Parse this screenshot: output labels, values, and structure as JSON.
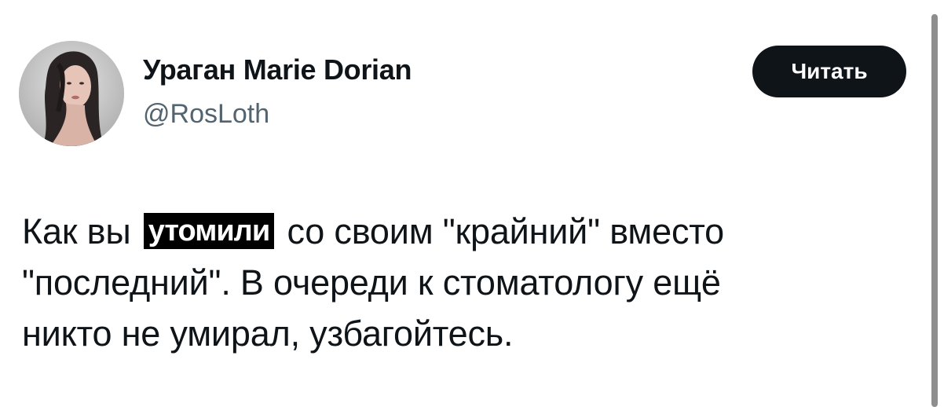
{
  "tweet": {
    "author": {
      "display_name": "Ураган Marie Dorian",
      "handle": "@RosLoth",
      "avatar_icon": "profile-photo"
    },
    "read_button_label": "Читать",
    "text": {
      "line1_before": "Как вы",
      "line1_highlight": "утомили",
      "line1_after": "со своим \"крайний\" вместо",
      "line2": "\"последний\". В очереди к стоматологу ещё",
      "line3": "никто не умирал, узбагойтесь."
    }
  },
  "colors": {
    "text_primary": "#0f1419",
    "text_secondary": "#536471",
    "button_bg": "#0f1419",
    "button_text": "#ffffff",
    "highlight_bg": "#000000"
  }
}
